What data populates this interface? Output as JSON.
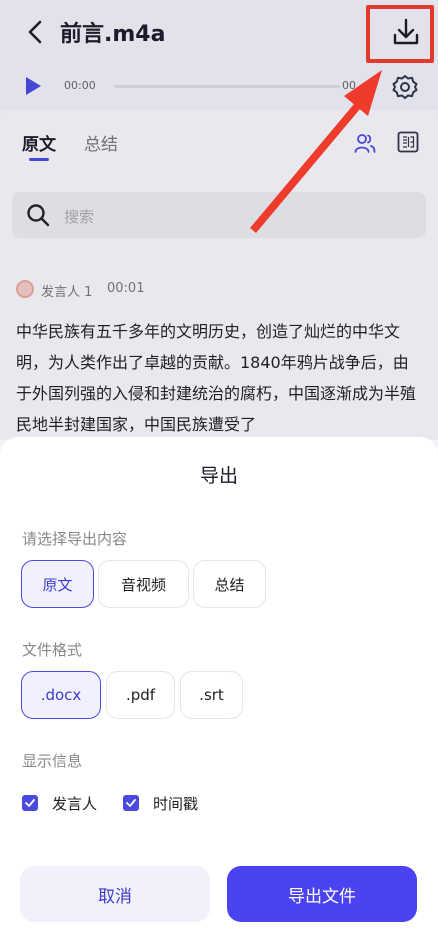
{
  "header": {
    "title": "前言.m4a",
    "back_icon": "chevron-left-icon",
    "download_icon": "download-icon"
  },
  "player": {
    "time_start": "00:00",
    "time_end": "00",
    "progress": 0,
    "play_icon": "play-icon",
    "settings_icon": "gear-icon"
  },
  "tabs": [
    {
      "label": "原文",
      "active": true
    },
    {
      "label": "总结",
      "active": false
    }
  ],
  "toolbar": {
    "speakers_icon": "speakers-icon",
    "translate_icon": "translate-icon"
  },
  "search": {
    "placeholder": "搜索"
  },
  "transcript": {
    "speaker": "发言人 1",
    "time": "00:01",
    "text": "中华民族有五千多年的文明历史，创造了灿烂的中华文明，为人类作出了卓越的贡献。1840年鸦片战争后，由于外国列强的入侵和封建统治的腐朽，中国逐渐成为半殖民地半封建国家，中国民族遭受了"
  },
  "export_sheet": {
    "title": "导出",
    "content_label": "请选择导出内容",
    "content_options": [
      {
        "label": "原文",
        "selected": true
      },
      {
        "label": "音视频",
        "selected": false
      },
      {
        "label": "总结",
        "selected": false
      }
    ],
    "format_label": "文件格式",
    "format_options": [
      {
        "label": ".docx",
        "selected": true
      },
      {
        "label": ".pdf",
        "selected": false
      },
      {
        "label": ".srt",
        "selected": false
      }
    ],
    "info_label": "显示信息",
    "info_options": [
      {
        "label": "发言人",
        "checked": true
      },
      {
        "label": "时间戳",
        "checked": true
      }
    ],
    "cancel_label": "取消",
    "export_label": "导出文件"
  },
  "colors": {
    "accent": "#4a4adf",
    "primary_button": "#4b43f0",
    "annotation": "#ee3b2b"
  }
}
